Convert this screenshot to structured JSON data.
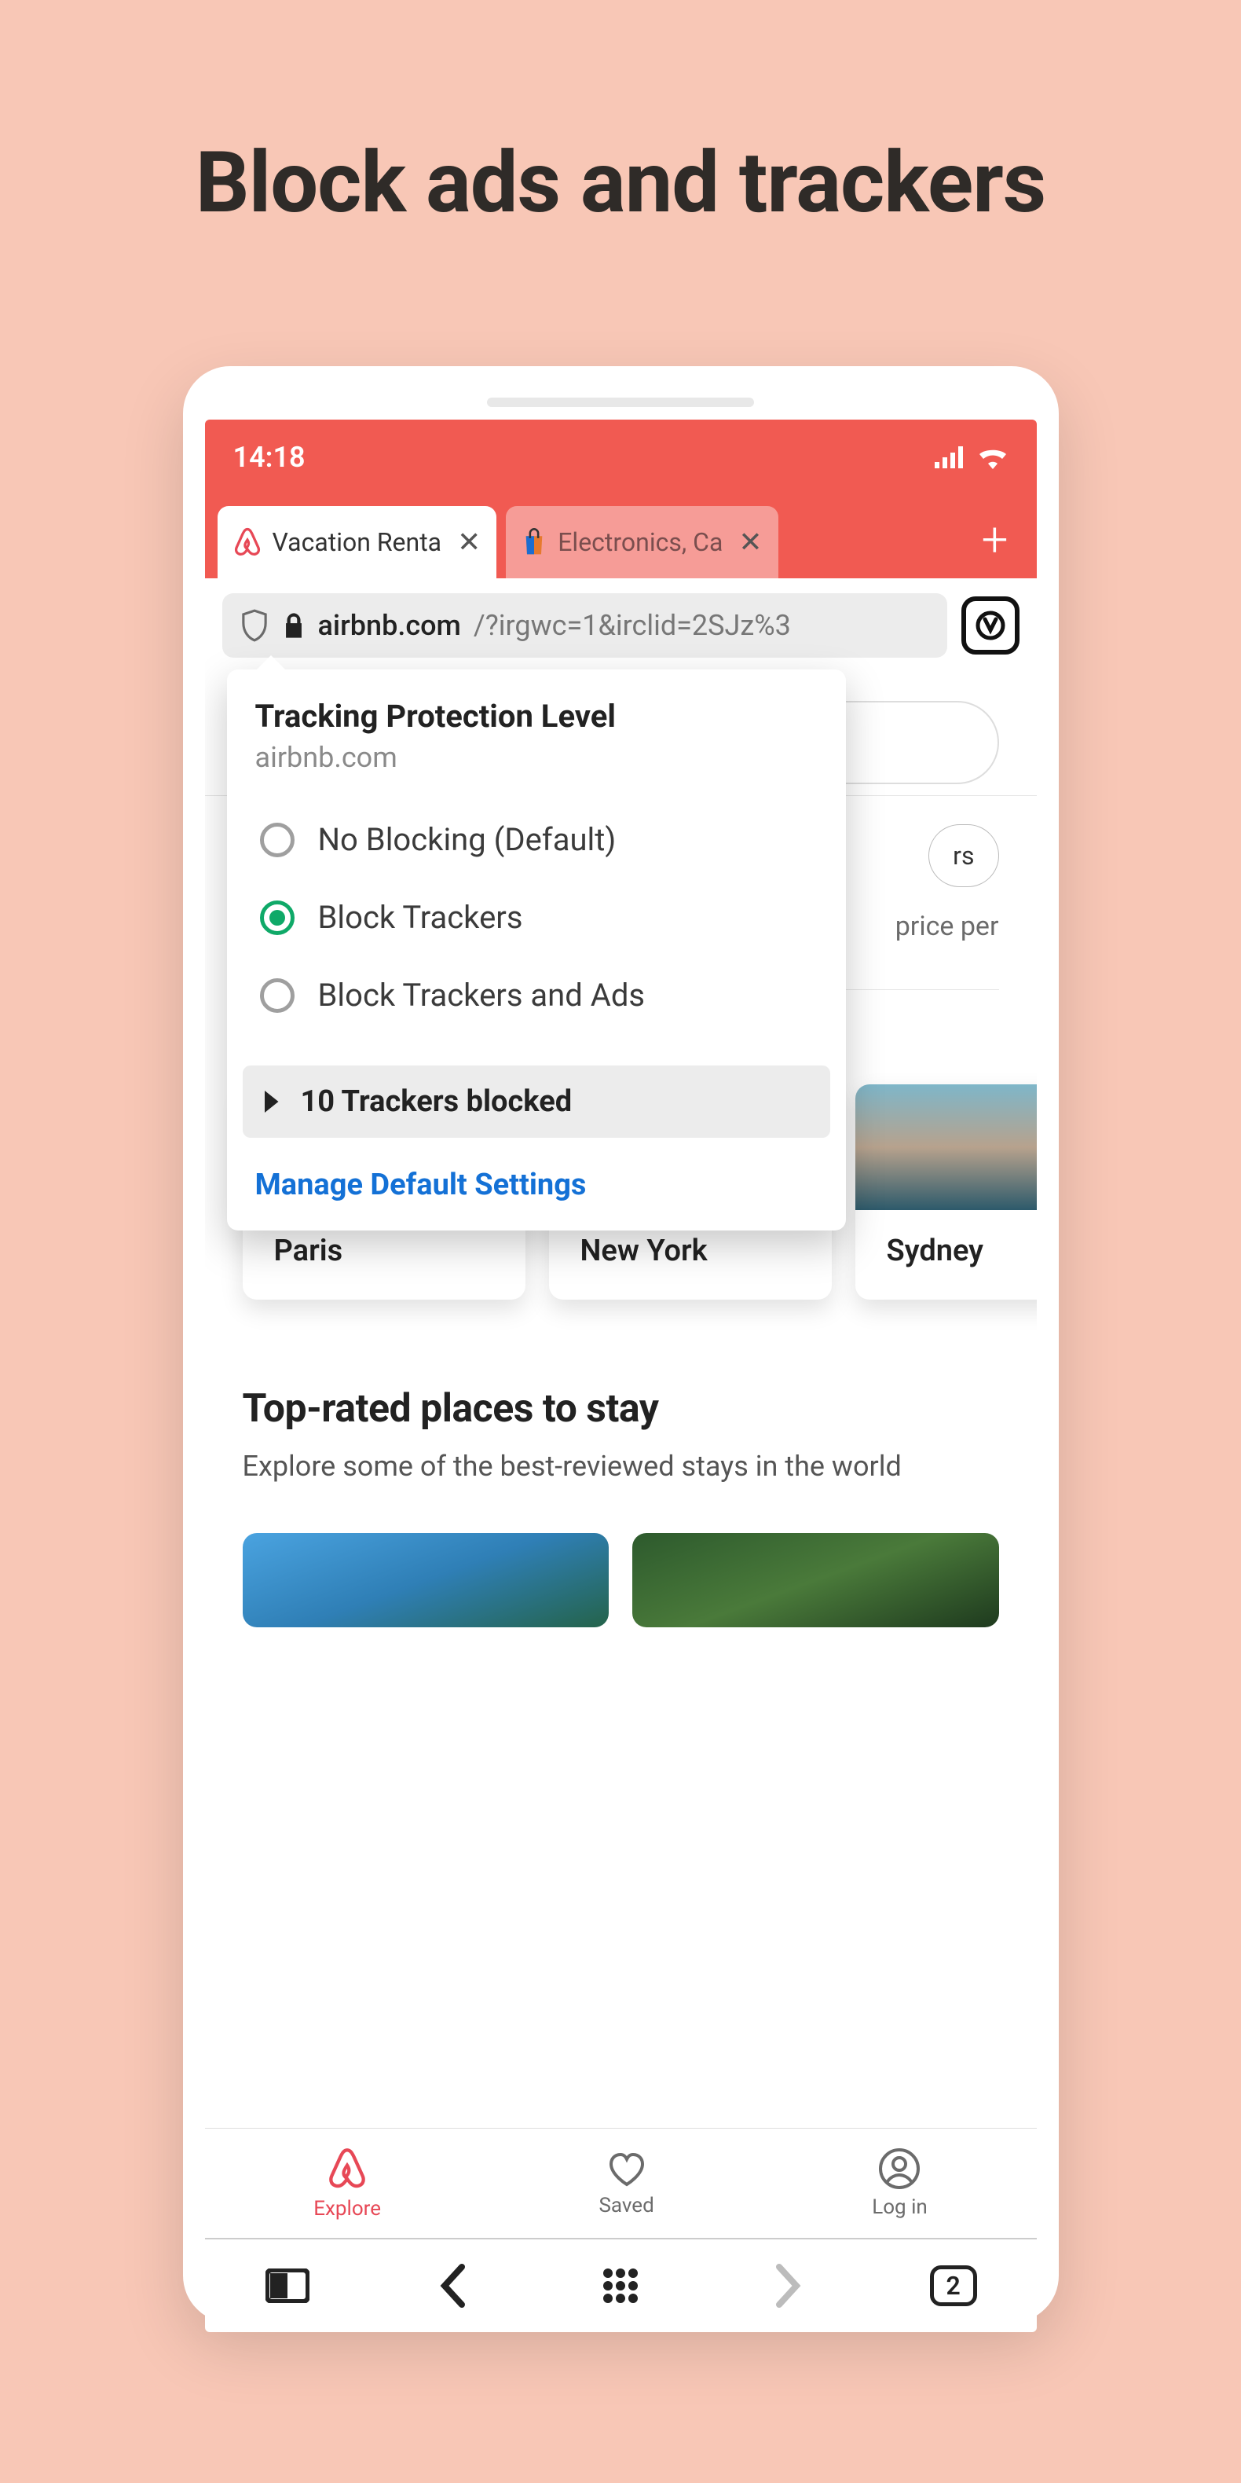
{
  "hero_title": "Block ads and trackers",
  "status": {
    "time": "14:18"
  },
  "tabs": {
    "items": [
      {
        "label": "Vacation Renta"
      },
      {
        "label": "Electronics, Ca"
      }
    ]
  },
  "address": {
    "domain": "airbnb.com",
    "rest": "/?irgwc=1&irclid=2SJz%3"
  },
  "popover": {
    "title": "Tracking Protection Level",
    "domain": "airbnb.com",
    "options": [
      {
        "label": "No Blocking (Default)",
        "selected": false
      },
      {
        "label": "Block Trackers",
        "selected": true
      },
      {
        "label": "Block Trackers and Ads",
        "selected": false
      }
    ],
    "blocked_label": "10 Trackers blocked",
    "manage_label": "Manage Default Settings"
  },
  "page": {
    "pill_label": "rs",
    "price_text": "price per",
    "destinations": [
      {
        "label": "Paris"
      },
      {
        "label": "New York"
      },
      {
        "label": "Sydney"
      }
    ],
    "section_title": "Top-rated places to stay",
    "section_sub": "Explore some of the best-reviewed stays in the world"
  },
  "airbnb_nav": {
    "explore": "Explore",
    "saved": "Saved",
    "login": "Log in"
  },
  "browser_toolbar": {
    "tab_count": "2"
  },
  "colors": {
    "brand_red": "#f15a52",
    "accent_green": "#0fa968",
    "link_blue": "#1471d6"
  }
}
